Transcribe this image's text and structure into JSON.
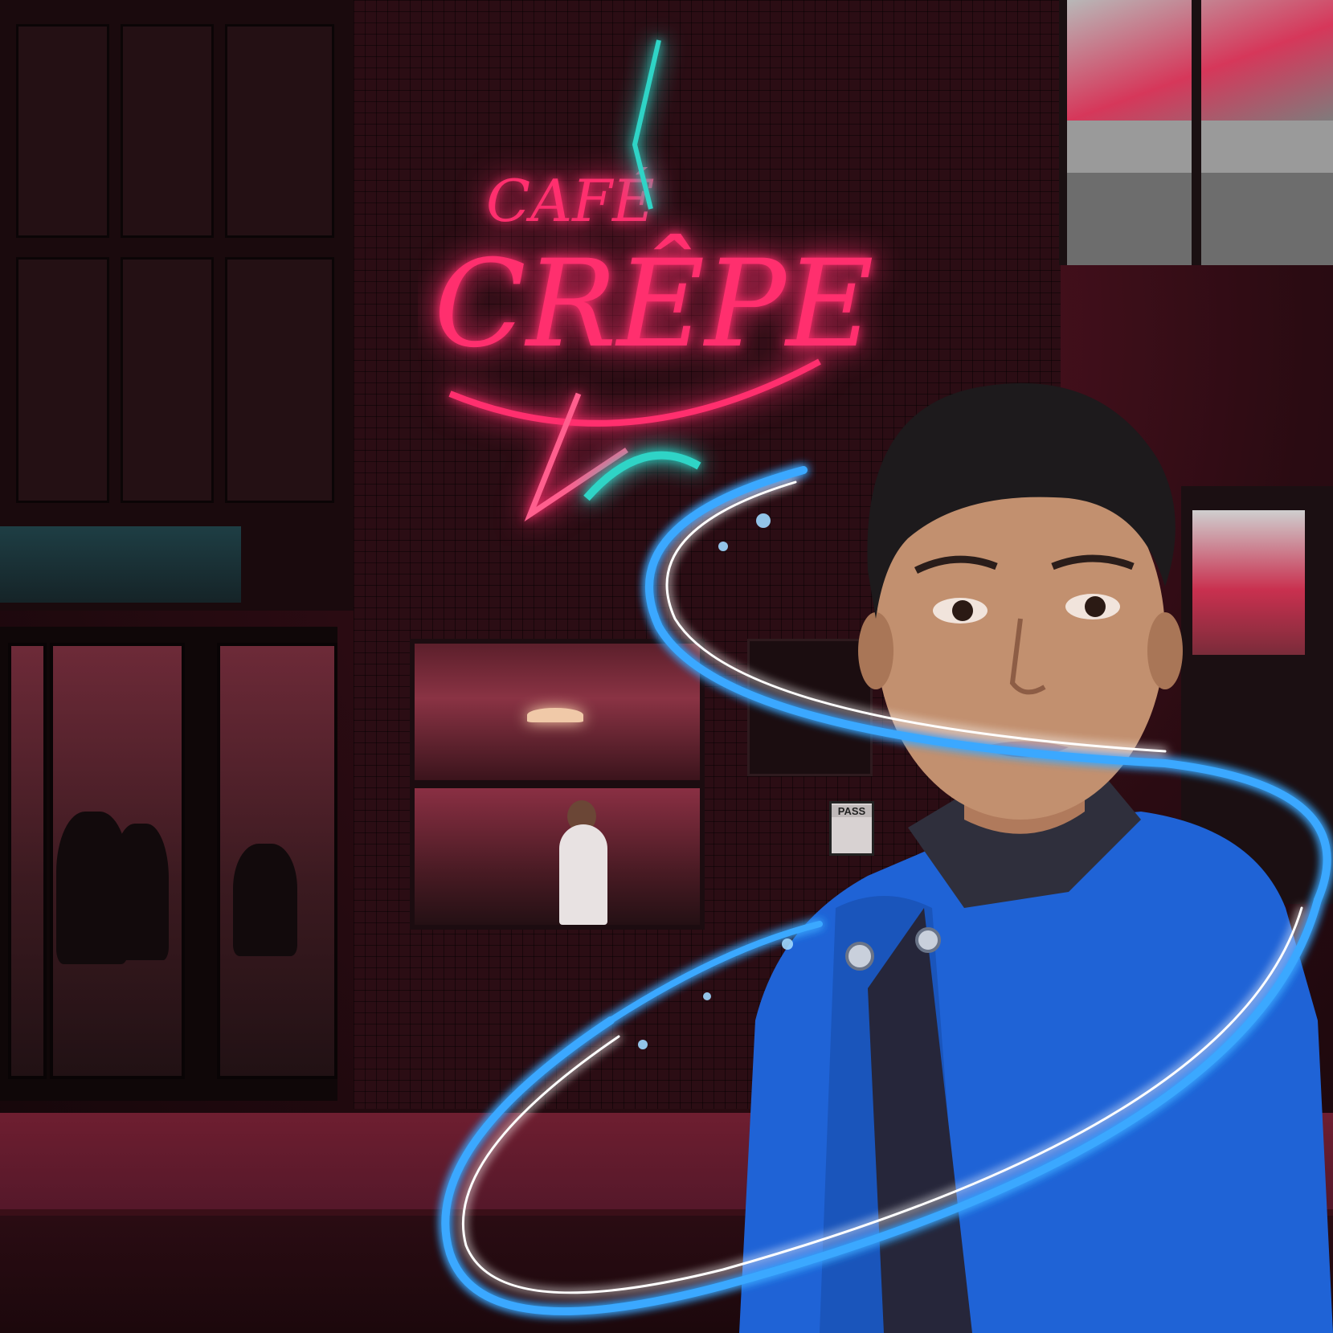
{
  "sign": {
    "line1": "CAFÉ",
    "line2": "CRÊPE"
  },
  "pass_sign": {
    "label": "PASS"
  },
  "colors": {
    "neon_pink": "#ff2f6e",
    "neon_teal": "#2fd4c6",
    "swirl_blue": "#3aa8ff",
    "jacket_blue": "#1f63d6"
  }
}
